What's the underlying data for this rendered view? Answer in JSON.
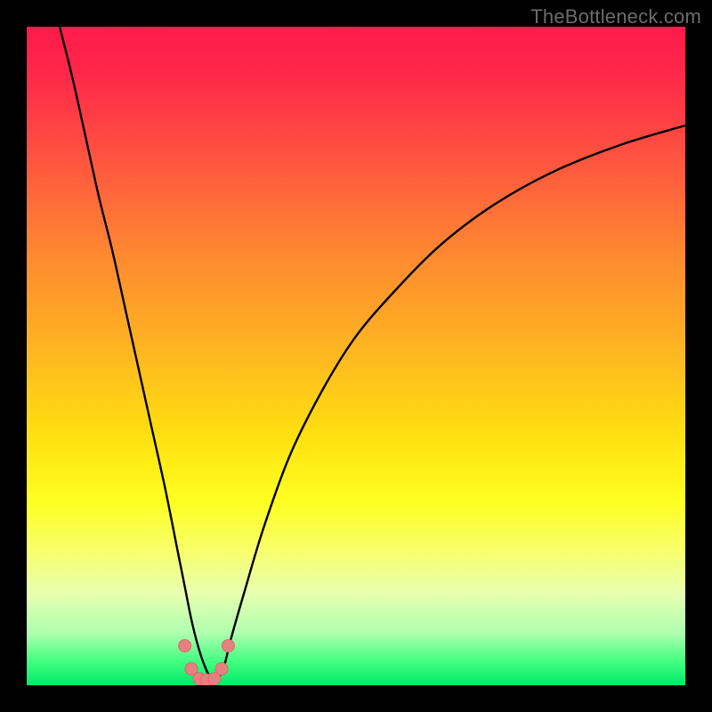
{
  "watermark": "TheBottleneck.com",
  "colors": {
    "gradient_stops": [
      {
        "offset": 0.0,
        "color": "#ff1a4b"
      },
      {
        "offset": 0.08,
        "color": "#ff2a49"
      },
      {
        "offset": 0.2,
        "color": "#ff5440"
      },
      {
        "offset": 0.35,
        "color": "#ff8a30"
      },
      {
        "offset": 0.5,
        "color": "#ffb820"
      },
      {
        "offset": 0.62,
        "color": "#ffe010"
      },
      {
        "offset": 0.72,
        "color": "#ffff20"
      },
      {
        "offset": 0.8,
        "color": "#f7ff70"
      },
      {
        "offset": 0.86,
        "color": "#e8ffb0"
      },
      {
        "offset": 0.92,
        "color": "#b0ffb0"
      },
      {
        "offset": 0.965,
        "color": "#40ff80"
      },
      {
        "offset": 1.0,
        "color": "#00e868"
      }
    ],
    "curve": "#000000",
    "marker_fill": "#e98080",
    "marker_stroke": "#d86a6a"
  },
  "chart_data": {
    "type": "line",
    "title": "",
    "xlabel": "",
    "ylabel": "",
    "xlim": [
      0,
      100
    ],
    "ylim": [
      0,
      100
    ],
    "series": [
      {
        "name": "bottleneck-curve",
        "x": [
          5,
          7,
          9,
          11,
          13,
          15,
          17,
          19,
          21,
          23,
          24,
          25,
          26,
          27,
          28,
          29,
          30,
          31,
          33,
          36,
          40,
          45,
          50,
          56,
          63,
          71,
          80,
          90,
          100
        ],
        "y": [
          100,
          92,
          83,
          74,
          66,
          57,
          48,
          39,
          30,
          20,
          15,
          10,
          6,
          3,
          1,
          1,
          3,
          7,
          14,
          24,
          35,
          45,
          53,
          60,
          67,
          73,
          78,
          82,
          85
        ]
      }
    ],
    "markers": {
      "name": "highlight-points",
      "x": [
        24.0,
        25.0,
        26.2,
        27.3,
        28.5,
        29.6,
        30.6
      ],
      "y": [
        6.0,
        2.5,
        1.0,
        0.8,
        1.0,
        2.5,
        6.0
      ]
    }
  }
}
